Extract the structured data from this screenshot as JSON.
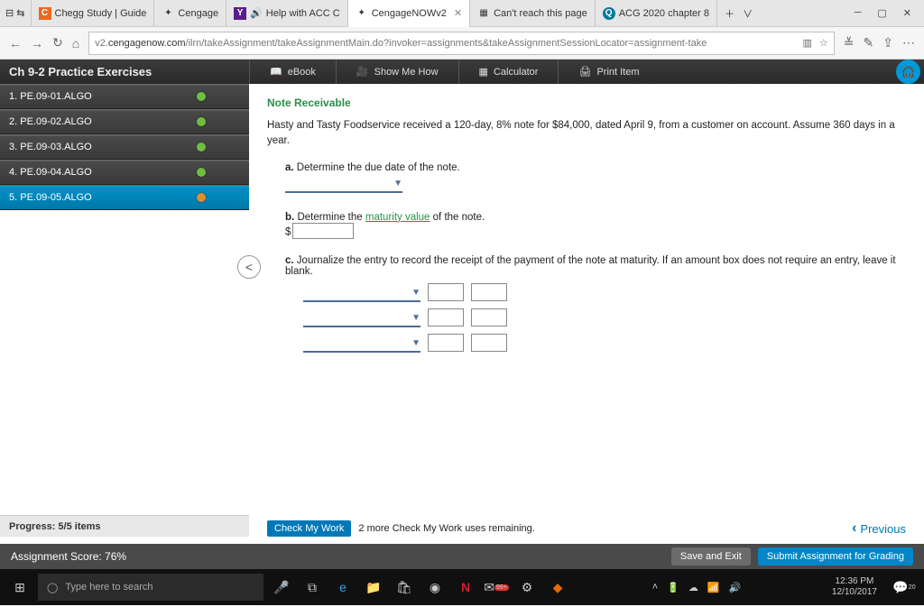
{
  "browser": {
    "tabs": [
      {
        "label": "Chegg Study | Guide",
        "icon": "C",
        "bg": "#e86a1f"
      },
      {
        "label": "Cengage",
        "icon": "✦",
        "bg": "#fff"
      },
      {
        "label": "Help with ACC C",
        "icon": "Y",
        "bg": "#5a1e8a",
        "audio": true
      },
      {
        "label": "CengageNOWv2",
        "icon": "✦",
        "bg": "#fff",
        "active": true
      },
      {
        "label": "Can't reach this page",
        "icon": "▦",
        "bg": "#ddd"
      },
      {
        "label": "ACG 2020 chapter 8",
        "icon": "Q",
        "bg": "#007a9c"
      }
    ],
    "url_pre": "v2.",
    "url_host": "cengagenow.com",
    "url_path": "/ilrn/takeAssignment/takeAssignmentMain.do?invoker=assignments&takeAssignmentSessionLocator=assignment-take"
  },
  "header": {
    "title": "Ch 9-2 Practice Exercises",
    "btns": [
      "eBook",
      "Show Me How",
      "Calculator",
      "Print Item"
    ]
  },
  "sidebar": {
    "items": [
      {
        "label": "1. PE.09-01.ALGO"
      },
      {
        "label": "2. PE.09-02.ALGO"
      },
      {
        "label": "3. PE.09-03.ALGO"
      },
      {
        "label": "4. PE.09-04.ALGO"
      },
      {
        "label": "5. PE.09-05.ALGO",
        "active": true,
        "orange": true
      }
    ],
    "progress": "Progress:  5/5 items"
  },
  "content": {
    "title": "Note Receivable",
    "intro": "Hasty and Tasty Foodservice received a 120-day, 8% note for $84,000, dated April 9, from a customer on account. Assume 360 days in a year.",
    "a": "Determine the due date of the note.",
    "b_pre": "Determine the ",
    "b_term": "maturity value",
    "b_post": " of the note.",
    "c": "Journalize the entry to record the receipt of the payment of the note at maturity. If an amount box does not require an entry, leave it blank.",
    "check_btn": "Check My Work",
    "check_txt": "2 more Check My Work uses remaining.",
    "prev": "Previous"
  },
  "footer": {
    "score": "Assignment Score: 76%",
    "save": "Save and Exit",
    "submit": "Submit Assignment for Grading"
  },
  "taskbar": {
    "search": "Type here to search",
    "time": "12:36 PM",
    "date": "12/10/2017"
  }
}
